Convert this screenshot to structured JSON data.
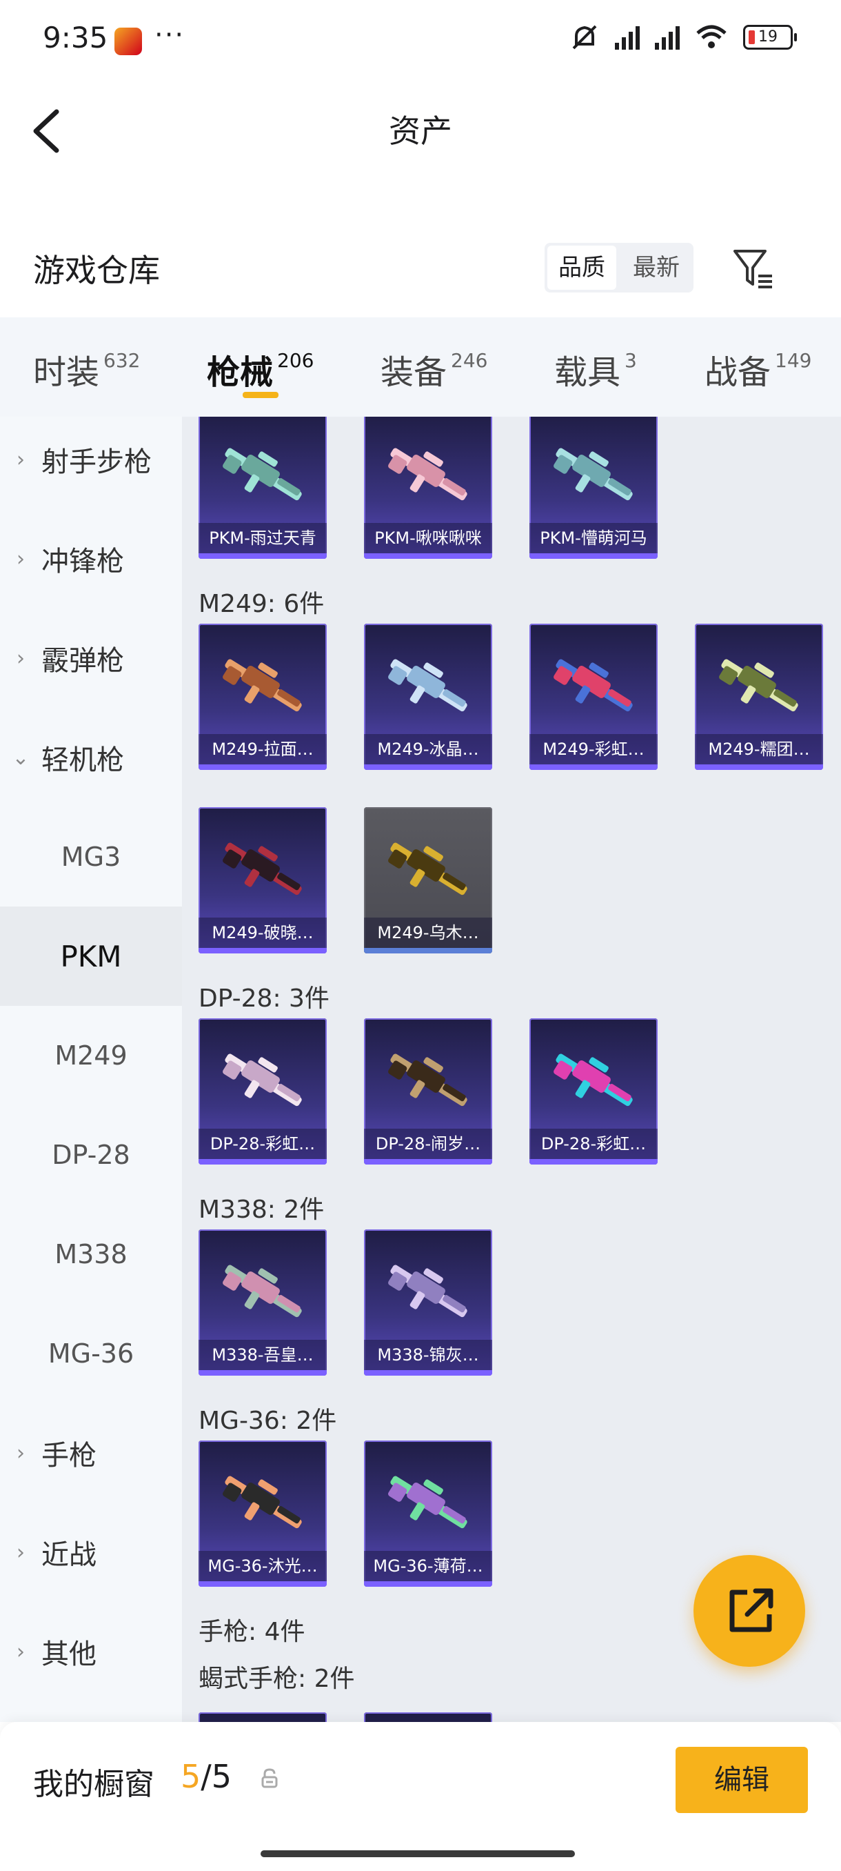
{
  "status_bar": {
    "time": "9:35",
    "more": "···",
    "battery": "19"
  },
  "header": {
    "title": "资产"
  },
  "warehouse": {
    "title": "游戏仓库",
    "sort_options": [
      "品质",
      "最新"
    ]
  },
  "tabs": [
    {
      "label": "时装",
      "count": "632"
    },
    {
      "label": "枪械",
      "count": "206"
    },
    {
      "label": "装备",
      "count": "246"
    },
    {
      "label": "载具",
      "count": "3"
    },
    {
      "label": "战备",
      "count": "149"
    }
  ],
  "sidebar": [
    {
      "label": "射手步枪",
      "type": "category",
      "chevron": "›"
    },
    {
      "label": "冲锋枪",
      "type": "category",
      "chevron": "›"
    },
    {
      "label": "霰弹枪",
      "type": "category",
      "chevron": "›"
    },
    {
      "label": "轻机枪",
      "type": "category",
      "chevron": "⌄"
    },
    {
      "label": "MG3",
      "type": "sub"
    },
    {
      "label": "PKM",
      "type": "sub"
    },
    {
      "label": "M249",
      "type": "sub"
    },
    {
      "label": "DP-28",
      "type": "sub"
    },
    {
      "label": "M338",
      "type": "sub"
    },
    {
      "label": "MG-36",
      "type": "sub"
    },
    {
      "label": "手枪",
      "type": "category",
      "chevron": "›"
    },
    {
      "label": "近战",
      "type": "category",
      "chevron": "›"
    },
    {
      "label": "其他",
      "type": "category",
      "chevron": "›"
    }
  ],
  "groups": [
    {
      "title": "",
      "items": [
        "PKM-雨过天青",
        "PKM-啾咪啾咪",
        "PKM-懵萌河马"
      ]
    },
    {
      "title": "M249: 6件",
      "items": [
        "M249-拉面…",
        "M249-冰晶…",
        "M249-彩虹…",
        "M249-糯团…",
        "M249-破晓…",
        "M249-乌木…"
      ]
    },
    {
      "title": "DP-28: 3件",
      "items": [
        "DP-28-彩虹…",
        "DP-28-闹岁…",
        "DP-28-彩虹…"
      ]
    },
    {
      "title": "M338: 2件",
      "items": [
        "M338-吾皇…",
        "M338-锦灰…"
      ]
    },
    {
      "title": "MG-36: 2件",
      "items": [
        "MG-36-沐光…",
        "MG-36-薄荷…"
      ]
    },
    {
      "title": "手枪: 4件",
      "items": []
    },
    {
      "title": "蝎式手枪: 2件",
      "items": []
    }
  ],
  "footer": {
    "showcase_label": "我的橱窗",
    "showcase_current": "5",
    "showcase_total": "/5",
    "edit_label": "编辑"
  },
  "colors": {
    "accent": "#f7b21b",
    "card_purple": "#3a3480",
    "card_gray": "#4a4a52"
  }
}
